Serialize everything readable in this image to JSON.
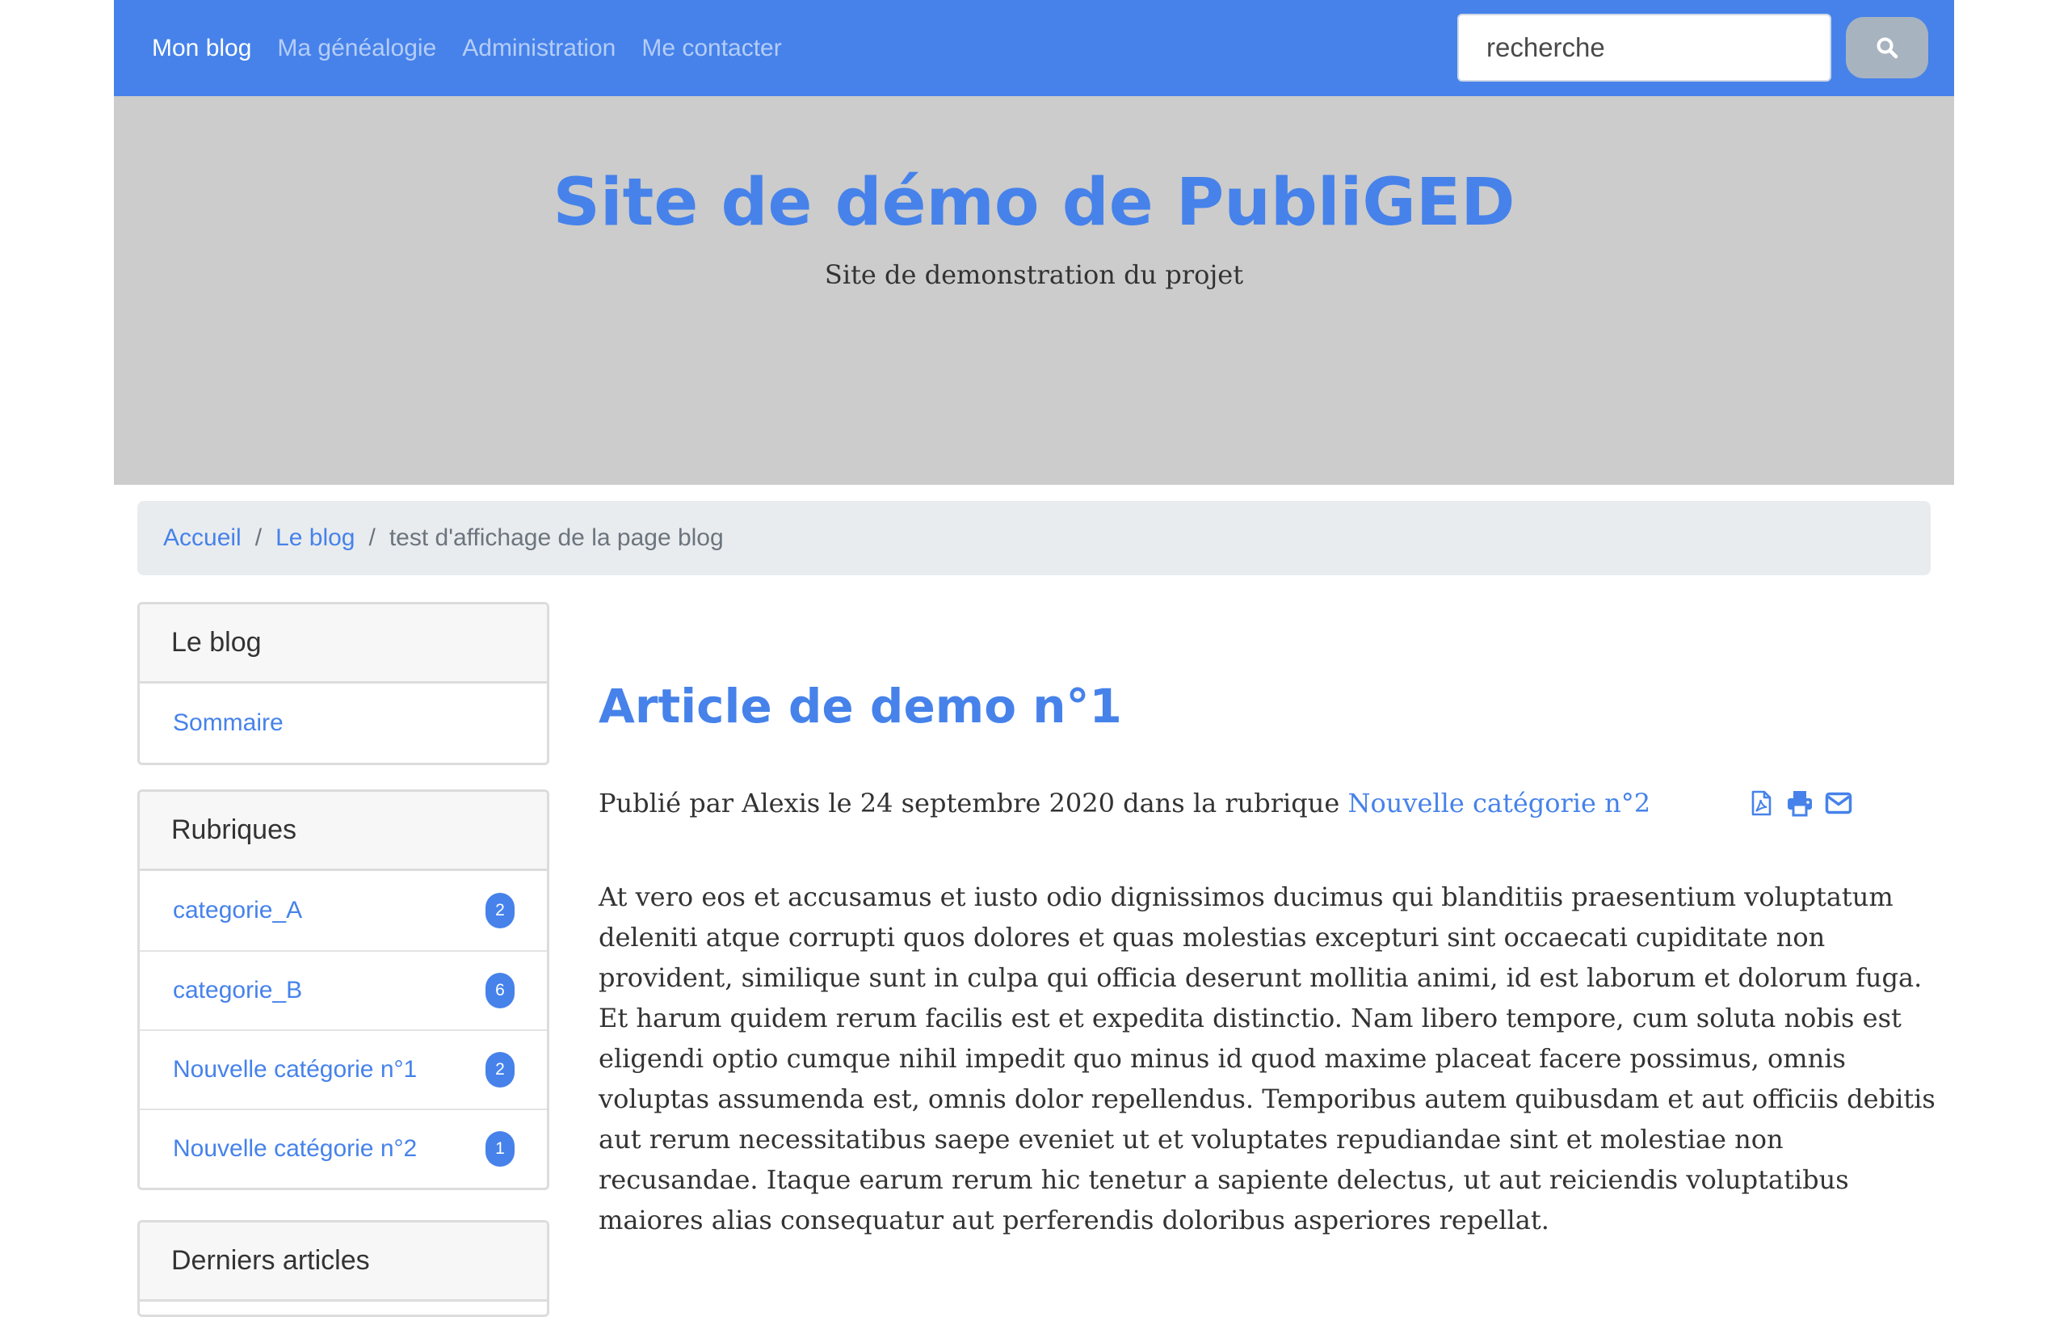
{
  "navbar": {
    "links": [
      {
        "label": "Mon blog",
        "active": true
      },
      {
        "label": "Ma généalogie",
        "active": false
      },
      {
        "label": "Administration",
        "active": false
      },
      {
        "label": "Me contacter",
        "active": false
      }
    ],
    "search": {
      "placeholder": "recherche",
      "button_icon": "search-icon"
    },
    "color": "#4682ea"
  },
  "hero": {
    "title": "Site de démo de PubliGED",
    "subtitle": "Site de demonstration du projet"
  },
  "breadcrumb": {
    "items": [
      "Accueil",
      "Le blog"
    ],
    "separator": "/",
    "current": "test d'affichage de la page blog"
  },
  "sidebar": {
    "blog": {
      "header": "Le blog",
      "items": [
        {
          "label": "Sommaire"
        }
      ]
    },
    "categories": {
      "header": "Rubriques",
      "items": [
        {
          "label": "categorie_A",
          "count": "2"
        },
        {
          "label": "categorie_B",
          "count": "6"
        },
        {
          "label": "Nouvelle catégorie n°1",
          "count": "2"
        },
        {
          "label": "Nouvelle catégorie n°2",
          "count": "1"
        }
      ]
    },
    "latest": {
      "header": "Derniers articles"
    }
  },
  "article": {
    "title": "Article de demo n°1",
    "meta": {
      "prefix": "Publié par Alexis le 24 septembre 2020 dans la rubrique ",
      "category": "Nouvelle catégorie n°2"
    },
    "actions": [
      "file-pdf-icon",
      "print-icon",
      "envelope-icon"
    ],
    "body": "At vero eos et accusamus et iusto odio dignissimos ducimus qui blanditiis praesentium voluptatum deleniti atque corrupti quos dolores et quas molestias excepturi sint occaecati cupiditate non provident, similique sunt in culpa qui officia deserunt mollitia animi, id est laborum et dolorum fuga. Et harum quidem rerum facilis est et expedita distinctio. Nam libero tempore, cum soluta nobis est eligendi optio cumque nihil impedit quo minus id quod maxime placeat facere possimus, omnis voluptas assumenda est, omnis dolor repellendus. Temporibus autem quibusdam et aut officiis debitis aut rerum necessitatibus saepe eveniet ut et voluptates repudiandae sint et molestiae non recusandae. Itaque earum rerum hic tenetur a sapiente delectus, ut aut reiciendis voluptatibus maiores alias consequatur aut perferendis doloribus asperiores repellat."
  }
}
